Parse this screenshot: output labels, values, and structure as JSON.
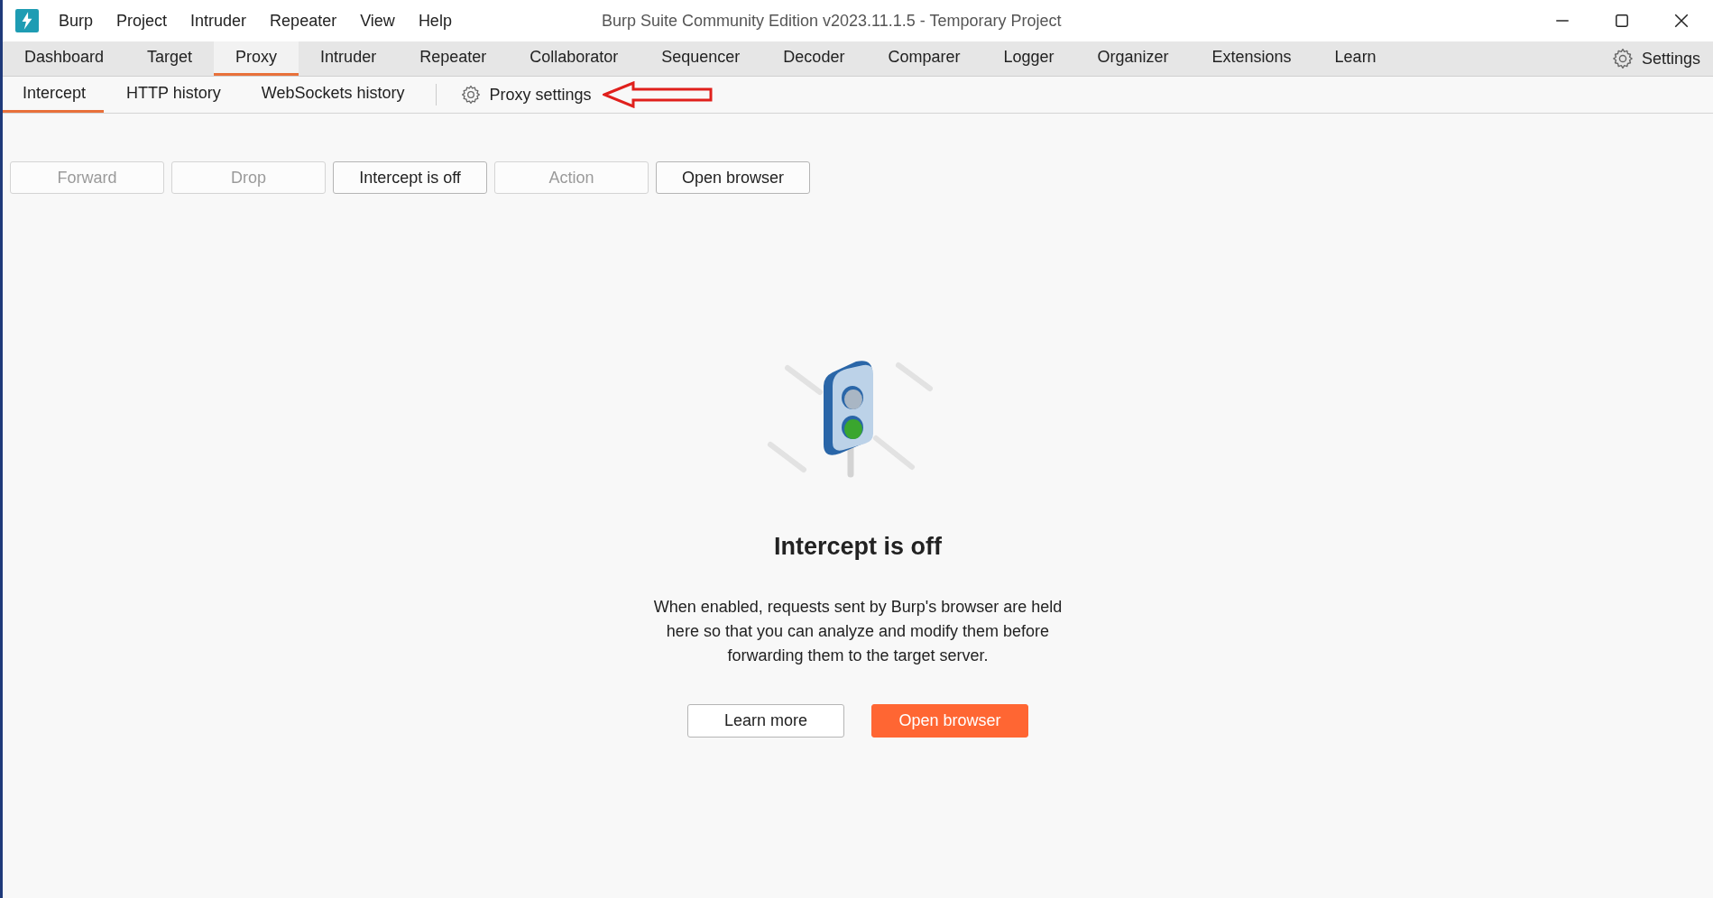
{
  "window": {
    "title": "Burp Suite Community Edition v2023.11.1.5 - Temporary Project"
  },
  "menu": [
    "Burp",
    "Project",
    "Intruder",
    "Repeater",
    "View",
    "Help"
  ],
  "main_tabs": [
    {
      "label": "Dashboard",
      "selected": false
    },
    {
      "label": "Target",
      "selected": false
    },
    {
      "label": "Proxy",
      "selected": true
    },
    {
      "label": "Intruder",
      "selected": false
    },
    {
      "label": "Repeater",
      "selected": false
    },
    {
      "label": "Collaborator",
      "selected": false
    },
    {
      "label": "Sequencer",
      "selected": false
    },
    {
      "label": "Decoder",
      "selected": false
    },
    {
      "label": "Comparer",
      "selected": false
    },
    {
      "label": "Logger",
      "selected": false
    },
    {
      "label": "Organizer",
      "selected": false
    },
    {
      "label": "Extensions",
      "selected": false
    },
    {
      "label": "Learn",
      "selected": false
    }
  ],
  "settings": {
    "label": "Settings"
  },
  "sub_tabs": [
    {
      "label": "Intercept",
      "selected": true
    },
    {
      "label": "HTTP history",
      "selected": false
    },
    {
      "label": "WebSockets history",
      "selected": false
    }
  ],
  "proxy_settings": {
    "label": "Proxy settings"
  },
  "toolbar": [
    {
      "label": "Forward",
      "disabled": true
    },
    {
      "label": "Drop",
      "disabled": true
    },
    {
      "label": "Intercept is off",
      "disabled": false
    },
    {
      "label": "Action",
      "disabled": true
    },
    {
      "label": "Open browser",
      "disabled": false
    }
  ],
  "empty_state": {
    "heading": "Intercept is off",
    "text": "When enabled, requests sent by Burp's browser are held here so that you can analyze and modify them before forwarding them to the target server.",
    "buttons": [
      {
        "label": "Learn more",
        "kind": "secondary"
      },
      {
        "label": "Open browser",
        "kind": "primary"
      }
    ]
  }
}
